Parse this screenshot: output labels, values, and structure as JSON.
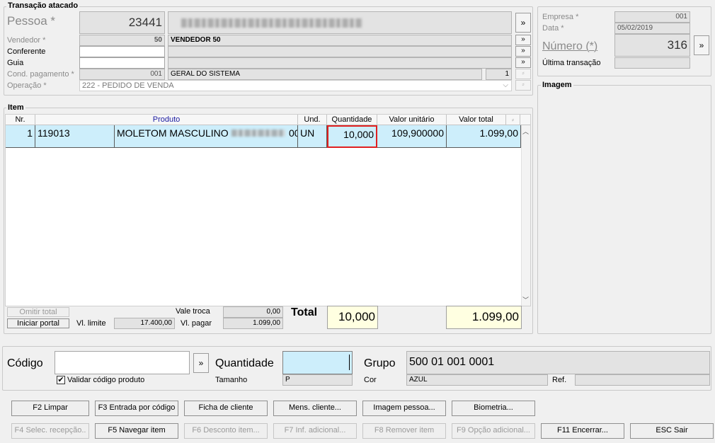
{
  "transacao": {
    "title": "Transação atacado",
    "pessoa_label": "Pessoa *",
    "pessoa_code": "23441",
    "vendedor_label": "Vendedor *",
    "vendedor_code": "50",
    "vendedor_name": "VENDEDOR 50",
    "conferente_label": "Conferente",
    "guia_label": "Guia",
    "cond_label": "Cond. pagamento *",
    "cond_code": "001",
    "cond_name": "GERAL DO SISTEMA",
    "cond_parcelas": "1",
    "operacao_label": "Operação *",
    "operacao_value": "222 - PEDIDO DE VENDA",
    "chevron": "»"
  },
  "header_right": {
    "empresa_label": "Empresa *",
    "empresa_value": "001",
    "data_label": "Data *",
    "data_value": "05/02/2019",
    "numero_label": "Número (*)",
    "numero_value": "316",
    "ultima_label": "Última transação",
    "chevron": "»"
  },
  "imagem": {
    "title": "Imagem"
  },
  "item": {
    "title": "Item",
    "columns": [
      "Nr.",
      "Produto",
      "Und.",
      "Quantidade",
      "Valor unitário",
      "Valor total"
    ],
    "row": {
      "nr": "1",
      "codigo": "119013",
      "produto": "MOLETOM MASCULINO",
      "produto_tail": "00",
      "und": "UN",
      "quantidade": "10,000",
      "valor_unitario": "109,900000",
      "valor_total": "1.099,00"
    }
  },
  "totals": {
    "omitir_total": "Omitir total",
    "iniciar_portal": "Iniciar portal",
    "vl_limite_label": "Vl. limite",
    "vl_limite": "17.400,00",
    "vale_troca_label": "Vale troca",
    "vale_troca": "0,00",
    "vl_pagar_label": "Vl. pagar",
    "vl_pagar": "1.099,00",
    "total_label": "Total",
    "total_qtd": "10,000",
    "total_valor": "1.099,00"
  },
  "entry": {
    "codigo_label": "Código",
    "validar_label": "Validar código produto",
    "validar_checked": true,
    "quantidade_label": "Quantidade",
    "tamanho_label": "Tamanho",
    "tamanho_value": "P",
    "grupo_label": "Grupo",
    "grupo_value": "500 01 001 0001",
    "cor_label": "Cor",
    "cor_value": "AZUL",
    "ref_label": "Ref.",
    "chevron": "»"
  },
  "buttons": {
    "f2": "F2 Limpar",
    "f3": "F3 Entrada por código",
    "ficha": "Ficha de cliente",
    "mens": "Mens. cliente...",
    "imagem_pessoa": "Imagem pessoa...",
    "biometria": "Biometria...",
    "f4": "F4 Selec. recepção..",
    "f5": "F5 Navegar item",
    "f6": "F6 Desconto item...",
    "f7": "F7 Inf. adicional...",
    "f8": "F8 Remover item",
    "f9": "F9 Opção adicional...",
    "f11": "F11 Encerrar...",
    "esc": "ESC Sair"
  },
  "colors": {
    "row_highlight": "#cdeefb",
    "total_bg": "#ffffe1",
    "qty_focus_border": "#e02020",
    "header_link": "#1a1aa0"
  }
}
